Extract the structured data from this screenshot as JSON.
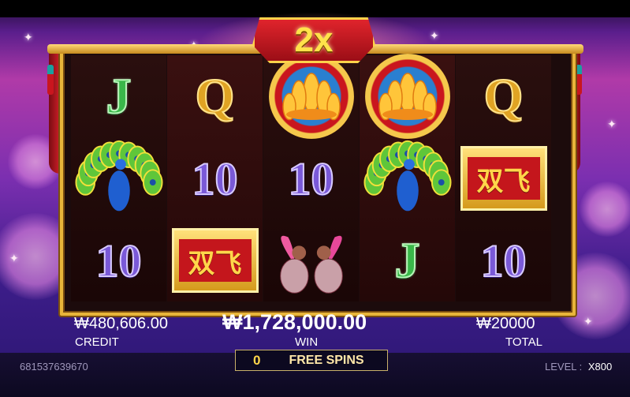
{
  "multiplier": "2x",
  "reels": [
    [
      {
        "type": "letter",
        "value": "J",
        "color": "green"
      },
      {
        "type": "peacock"
      },
      {
        "type": "number",
        "value": "10"
      }
    ],
    [
      {
        "type": "letter",
        "value": "Q",
        "color": "gold"
      },
      {
        "type": "number",
        "value": "10"
      },
      {
        "type": "plaque",
        "value": "双飞"
      }
    ],
    [
      {
        "type": "lotus"
      },
      {
        "type": "number",
        "value": "10"
      },
      {
        "type": "ducks"
      }
    ],
    [
      {
        "type": "lotus"
      },
      {
        "type": "peacock"
      },
      {
        "type": "letter",
        "value": "J",
        "color": "green"
      }
    ],
    [
      {
        "type": "letter",
        "value": "Q",
        "color": "gold"
      },
      {
        "type": "plaque",
        "value": "双飞"
      },
      {
        "type": "number",
        "value": "10"
      }
    ]
  ],
  "credit": {
    "amount": "₩480,606.00",
    "label": "CREDIT"
  },
  "win": {
    "amount": "₩1,728,000.00",
    "label": "WIN"
  },
  "total": {
    "amount": "₩20000",
    "label": "TOTAL"
  },
  "free_spins": {
    "count": "0",
    "label": "FREE SPINS"
  },
  "session_id": "681537639670",
  "level": {
    "label": "LEVEL :",
    "value": "X800"
  },
  "colors": {
    "accent_gold": "#e8b53a",
    "banner_red": "#c4161c",
    "reel_bg": "#1c0b0c"
  }
}
